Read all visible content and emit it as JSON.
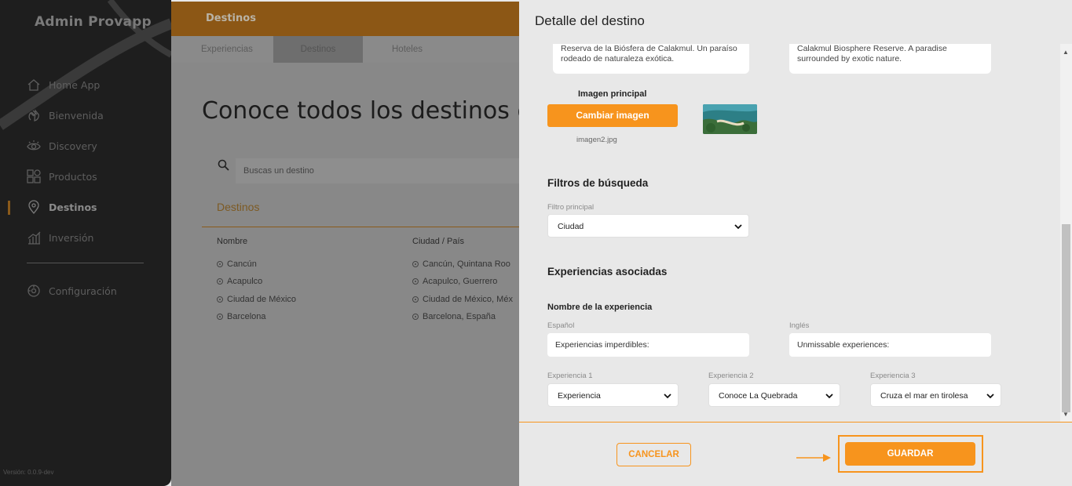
{
  "sidebar": {
    "brand": "Admin Provapp",
    "items": [
      {
        "label": "Home App",
        "icon": "home-icon"
      },
      {
        "label": "Bienvenida",
        "icon": "waving-hand-icon"
      },
      {
        "label": "Discovery",
        "icon": "eye-icon"
      },
      {
        "label": "Productos",
        "icon": "grid-icon"
      },
      {
        "label": "Destinos",
        "icon": "location-pin-icon",
        "active": true
      },
      {
        "label": "Inversión",
        "icon": "bar-chart-icon"
      },
      {
        "label": "Configuración",
        "icon": "settings-icon"
      }
    ],
    "version": "Versión: 0.0.9-dev"
  },
  "main": {
    "topbar_title": "Destinos",
    "tabs": [
      {
        "label": "Experiencias"
      },
      {
        "label": "Destinos",
        "active": true
      },
      {
        "label": "Hoteles"
      }
    ],
    "heading": "Conoce todos los destinos q",
    "search_placeholder": "Buscas un destino",
    "list_title": "Destinos",
    "columns": [
      "Nombre",
      "Ciudad / País"
    ],
    "rows": [
      {
        "name": "Cancún",
        "city": "Cancún, Quintana Roo"
      },
      {
        "name": "Acapulco",
        "city": "Acapulco, Guerrero"
      },
      {
        "name": "Ciudad de México",
        "city": "Ciudad de México, Méx"
      },
      {
        "name": "Barcelona",
        "city": "Barcelona, España"
      }
    ]
  },
  "panel": {
    "title": "Detalle del destino",
    "description_es": "Reserva de la Biósfera de Calakmul. Un paraíso rodeado de naturaleza exótica.",
    "description_en": "Calakmul Biosphere Reserve. A paradise surrounded by exotic nature.",
    "image_label": "Imagen principal",
    "change_image_button": "Cambiar imagen",
    "image_filename": "imagen2.jpg",
    "filters_heading": "Filtros de búsqueda",
    "filter_main_label": "Filtro principal",
    "filter_main_value": "Ciudad",
    "experiences_heading": "Experiencias asociadas",
    "experience_name_label": "Nombre de la experiencia",
    "spanish_label": "Español",
    "english_label": "Inglés",
    "experience_name_es": "Experiencias imperdibles:",
    "experience_name_en": "Unmissable experiences:",
    "experience1_label": "Experiencia 1",
    "experience1_value": "Experiencia",
    "experience2_label": "Experiencia 2",
    "experience2_value": "Conoce La Quebrada",
    "experience3_label": "Experiencia 3",
    "experience3_value": "Cruza el mar en tirolesa",
    "cancel_button": "CANCELAR",
    "save_button": "GUARDAR"
  },
  "colors": {
    "accent": "#f7941d",
    "sidebar_bg": "#1e1e1e",
    "panel_bg": "#e8e8e8"
  }
}
